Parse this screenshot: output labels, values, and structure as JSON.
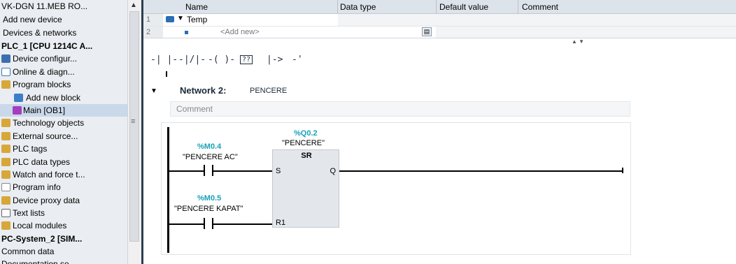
{
  "project_tree": {
    "items": [
      {
        "label": "VK-DGN 11.MEB RO...",
        "icon": "none",
        "bold": false
      },
      {
        "label": "Add new device",
        "icon": "none",
        "bold": false
      },
      {
        "label": "Devices & networks",
        "icon": "none",
        "bold": false
      },
      {
        "label": "PLC_1 [CPU 1214C A...",
        "icon": "none",
        "bold": true
      },
      {
        "label": "Device configur...",
        "icon": "device-config-icon",
        "bold": false
      },
      {
        "label": "Online & diagn...",
        "icon": "online-diag-icon",
        "bold": false
      },
      {
        "label": "Program blocks",
        "icon": "folder-icon",
        "bold": false
      },
      {
        "label": "Add new block",
        "icon": "add-block-icon",
        "bold": false
      },
      {
        "label": "Main [OB1]",
        "icon": "ob-icon",
        "bold": false
      },
      {
        "label": "Technology objects",
        "icon": "folder-icon",
        "bold": false
      },
      {
        "label": "External source...",
        "icon": "folder-icon",
        "bold": false
      },
      {
        "label": "PLC tags",
        "icon": "folder-icon",
        "bold": false
      },
      {
        "label": "PLC data types",
        "icon": "folder-icon",
        "bold": false
      },
      {
        "label": "Watch and force t...",
        "icon": "folder-icon",
        "bold": false
      },
      {
        "label": "Program info",
        "icon": "info-icon",
        "bold": false
      },
      {
        "label": "Device proxy data",
        "icon": "folder-icon",
        "bold": false
      },
      {
        "label": "Text lists",
        "icon": "text-list-icon",
        "bold": false
      },
      {
        "label": "Local modules",
        "icon": "folder-icon",
        "bold": false
      },
      {
        "label": "PC-System_2 [SIM...",
        "icon": "none",
        "bold": true
      },
      {
        "label": "Common data",
        "icon": "none",
        "bold": false
      },
      {
        "label": "Documentation se...",
        "icon": "none",
        "bold": false
      }
    ]
  },
  "interface_table": {
    "columns": [
      "Name",
      "Data type",
      "Default value",
      "Comment"
    ],
    "rows": [
      {
        "num": "1",
        "name": "Temp"
      },
      {
        "num": "2",
        "name": "<Add new>"
      }
    ]
  },
  "toolbar": {
    "buttons": [
      "-| |-",
      "-|/|-",
      "-( )-",
      "??",
      "|->",
      "-'"
    ]
  },
  "network": {
    "title": "Network 2:",
    "name": "PENCERE",
    "comment_placeholder": "Comment",
    "contact1_addr": "%M0.4",
    "contact1_tag": "\"PENCERE AC\"",
    "contact2_addr": "%M0.5",
    "contact2_tag": "\"PENCERE KAPAT\"",
    "block_addr": "%Q0.2",
    "block_tag": "\"PENCERE\"",
    "block_type": "SR",
    "pin_s": "S",
    "pin_q": "Q",
    "pin_r1": "R1"
  },
  "colors": {
    "address": "#16a2b8",
    "tree_bg": "#eaedf1",
    "selected_row": "#c9d9ea"
  }
}
